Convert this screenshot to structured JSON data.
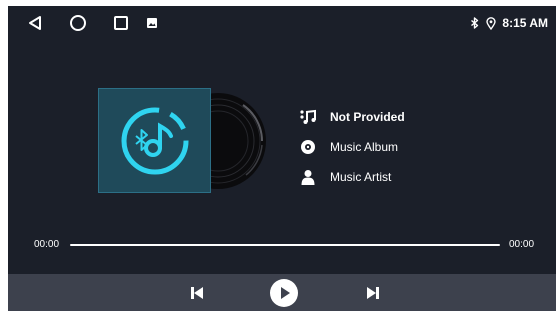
{
  "colors": {
    "background": "#1b1f29",
    "control_bar": "#3d414d",
    "accent": "#2fd4f0",
    "text": "#ffffff"
  },
  "status_bar": {
    "time": "8:15 AM",
    "nav_icons": [
      "back-triangle-icon",
      "home-circle-icon",
      "recents-square-icon",
      "gallery-notification-icon"
    ],
    "status_icons": [
      "bluetooth-icon",
      "location-pin-icon"
    ]
  },
  "track": {
    "title": "Not Provided",
    "album": "Music Album",
    "artist": "Music Artist",
    "icons": [
      "music-note-icon",
      "album-disc-icon",
      "artist-person-icon"
    ]
  },
  "progress": {
    "elapsed": "00:00",
    "duration": "00:00",
    "fraction": 0
  },
  "controls": {
    "icons": [
      "previous-track-icon",
      "play-icon",
      "next-track-icon"
    ]
  }
}
